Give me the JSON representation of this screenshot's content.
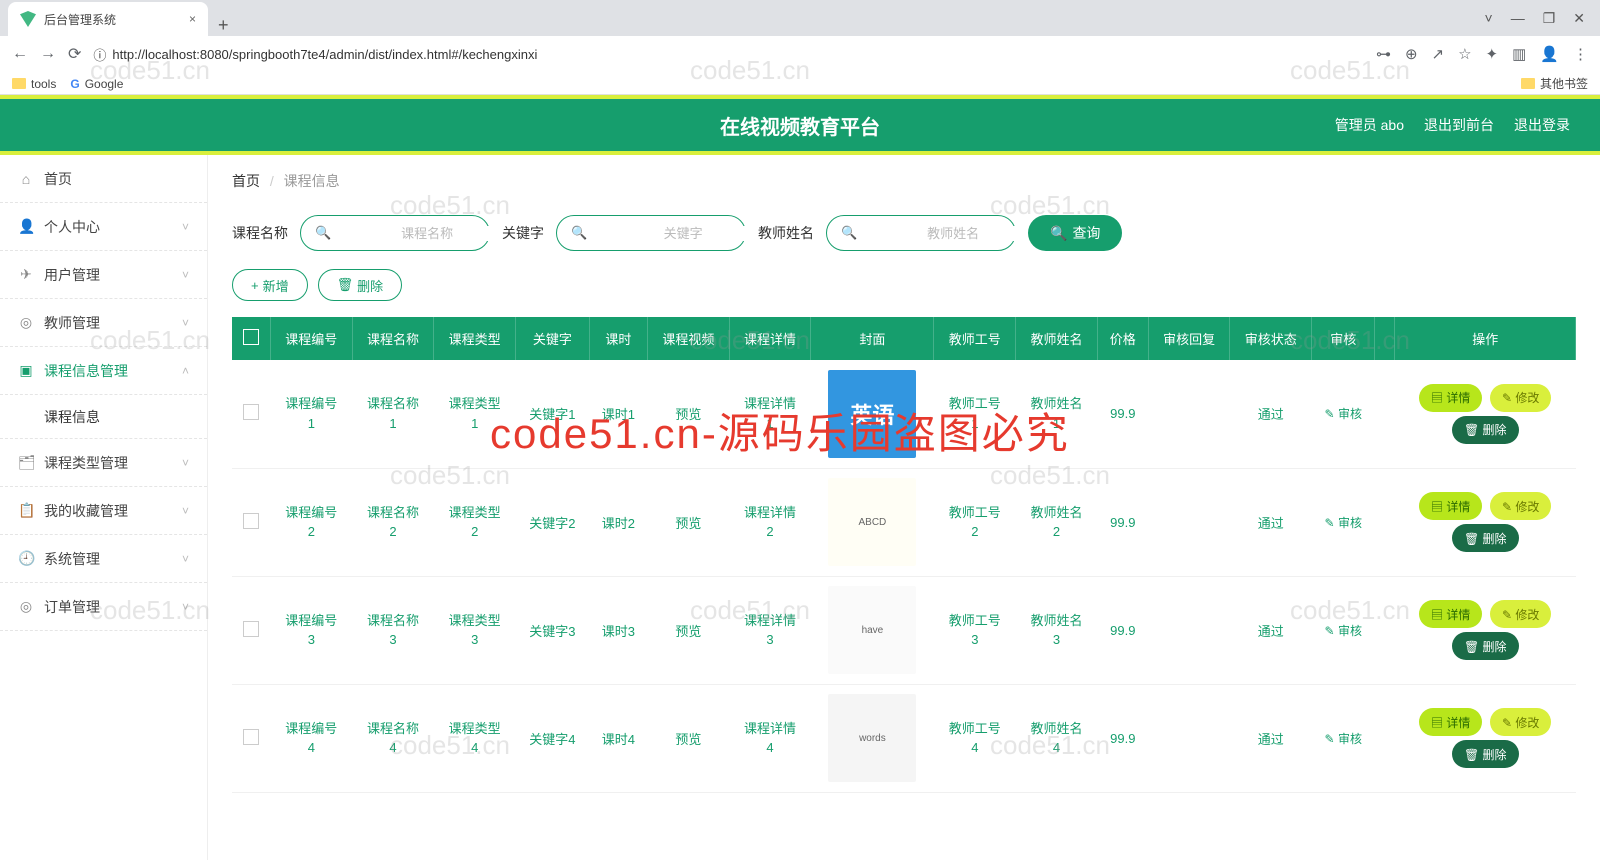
{
  "browser": {
    "tab_title": "后台管理系统",
    "url": "http://localhost:8080/springbooth7te4/admin/dist/index.html#/kechengxinxi",
    "bookmarks": {
      "tools": "tools",
      "google": "Google",
      "other": "其他书签"
    }
  },
  "header": {
    "title": "在线视频教育平台",
    "user": "管理员 abo",
    "go_front": "退出到前台",
    "logout": "退出登录"
  },
  "sidebar": {
    "items": [
      {
        "icon": "⌂",
        "label": "首页"
      },
      {
        "icon": "👤",
        "label": "个人中心",
        "arrow": "˅"
      },
      {
        "icon": "✈",
        "label": "用户管理",
        "arrow": "˅"
      },
      {
        "icon": "◎",
        "label": "教师管理",
        "arrow": "˅"
      },
      {
        "icon": "▣",
        "label": "课程信息管理",
        "arrow": "˄",
        "active": true
      },
      {
        "icon": "",
        "label": "课程信息",
        "sub": true
      },
      {
        "icon": "🗂",
        "label": "课程类型管理",
        "arrow": "˅"
      },
      {
        "icon": "📋",
        "label": "我的收藏管理",
        "arrow": "˅"
      },
      {
        "icon": "🕘",
        "label": "系统管理",
        "arrow": "˅"
      },
      {
        "icon": "◎",
        "label": "订单管理",
        "arrow": "˅"
      }
    ]
  },
  "breadcrumb": {
    "home": "首页",
    "current": "课程信息"
  },
  "search": {
    "label1": "课程名称",
    "ph1": "课程名称",
    "label2": "关键字",
    "ph2": "关键字",
    "label3": "教师姓名",
    "ph3": "教师姓名",
    "btn": "查询"
  },
  "actions": {
    "add": "新增",
    "del": "删除"
  },
  "table": {
    "headers": [
      "",
      "课程编号",
      "课程名称",
      "课程类型",
      "关键字",
      "课时",
      "课程视频",
      "课程详情",
      "封面",
      "教师工号",
      "教师姓名",
      "价格",
      "审核回复",
      "审核状态",
      "审核",
      "",
      "操作"
    ],
    "rows": [
      {
        "no": "课程编号1",
        "name": "课程名称1",
        "type": "课程类型1",
        "kw": "关键字1",
        "hours": "课时1",
        "video": "预览",
        "detail": "课程详情1",
        "tno": "教师工号1",
        "tname": "教师姓名1",
        "price": "99.9",
        "reply": "",
        "status": "通过",
        "audit": "审核"
      },
      {
        "no": "课程编号2",
        "name": "课程名称2",
        "type": "课程类型2",
        "kw": "关键字2",
        "hours": "课时2",
        "video": "预览",
        "detail": "课程详情2",
        "tno": "教师工号2",
        "tname": "教师姓名2",
        "price": "99.9",
        "reply": "",
        "status": "通过",
        "audit": "审核"
      },
      {
        "no": "课程编号3",
        "name": "课程名称3",
        "type": "课程类型3",
        "kw": "关键字3",
        "hours": "课时3",
        "video": "预览",
        "detail": "课程详情3",
        "tno": "教师工号3",
        "tname": "教师姓名3",
        "price": "99.9",
        "reply": "",
        "status": "通过",
        "audit": "审核"
      },
      {
        "no": "课程编号4",
        "name": "课程名称4",
        "type": "课程类型4",
        "kw": "关键字4",
        "hours": "课时4",
        "video": "预览",
        "detail": "课程详情4",
        "tno": "教师工号4",
        "tname": "教师姓名4",
        "price": "99.9",
        "reply": "",
        "status": "通过",
        "audit": "审核"
      }
    ],
    "ops": {
      "detail": "详情",
      "edit": "修改",
      "del": "删除"
    }
  },
  "watermark": {
    "text": "code51.cn",
    "red": "code51.cn-源码乐园盗图必究"
  }
}
